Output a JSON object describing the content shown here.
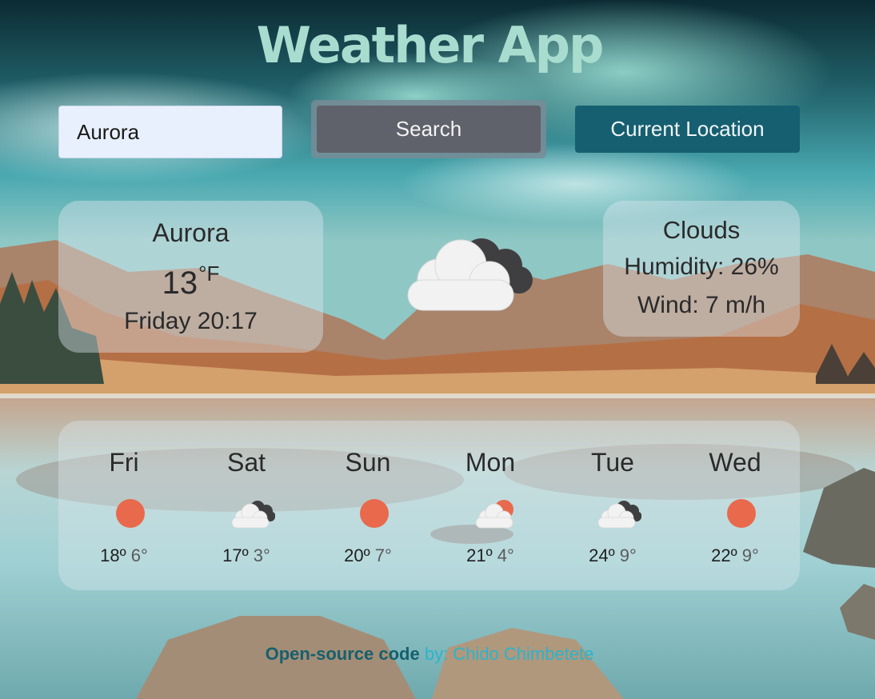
{
  "header": {
    "title": "Weather App"
  },
  "search": {
    "value": "Aurora",
    "button_label": "Search",
    "location_button_label": "Current Location"
  },
  "current": {
    "city": "Aurora",
    "temperature": "13",
    "unit": "°F",
    "datetime": "Friday 20:17",
    "description": "Clouds",
    "humidity": "Humidity: 26%",
    "wind": "Wind: 7 m/h",
    "icon": "broken-clouds-icon"
  },
  "forecast": [
    {
      "day": "Fri",
      "max": "18º",
      "min": "6°",
      "icon": "sun-icon"
    },
    {
      "day": "Sat",
      "max": "17º",
      "min": "3°",
      "icon": "broken-clouds-icon"
    },
    {
      "day": "Sun",
      "max": "20º",
      "min": "7°",
      "icon": "sun-icon"
    },
    {
      "day": "Mon",
      "max": "21º",
      "min": "4°",
      "icon": "partly-cloudy-icon"
    },
    {
      "day": "Tue",
      "max": "24º",
      "min": "9°",
      "icon": "broken-clouds-icon"
    },
    {
      "day": "Wed",
      "max": "22º",
      "min": "9°",
      "icon": "sun-icon"
    }
  ],
  "footer": {
    "link_text": "Open-source code",
    "by_text": " by: Chido Chimbetete"
  },
  "colors": {
    "sun": "#e9694c",
    "cloud_light": "#f2f2f2",
    "cloud_dark": "#3f3f42",
    "location_button": "#165f70",
    "search_button": "#5f626a"
  }
}
